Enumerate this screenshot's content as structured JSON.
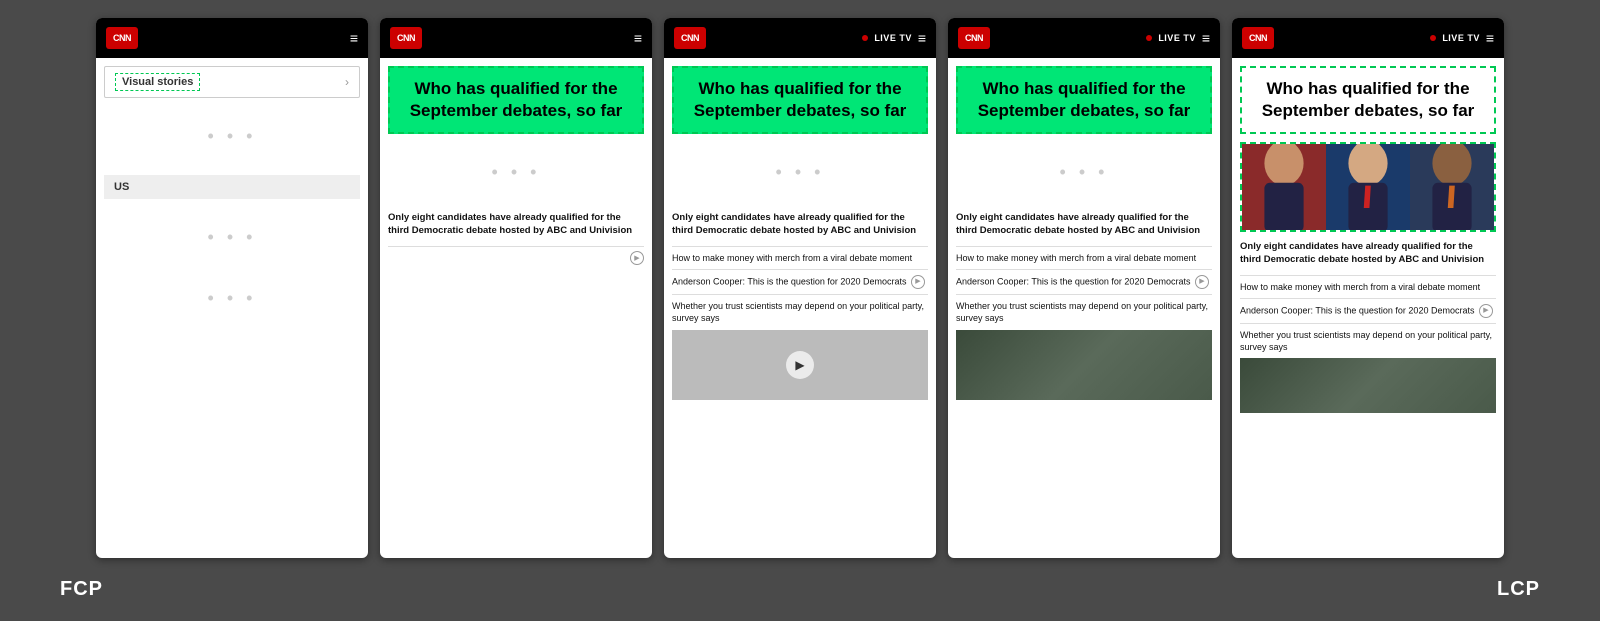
{
  "background_color": "#4a4a4a",
  "labels": {
    "fcp": "FCP",
    "lcp": "LCP"
  },
  "panels": [
    {
      "id": "panel1",
      "type": "visual_stories",
      "header": {
        "logo": "CNN",
        "show_live_tv": false,
        "show_hamburger": true
      },
      "visual_stories_label": "Visual stories",
      "us_section": "US",
      "has_dots": true
    },
    {
      "id": "panel2",
      "type": "article",
      "header": {
        "logo": "CNN",
        "show_live_tv": false,
        "show_hamburger": true
      },
      "headline": "Who has qualified for the September debates, so far",
      "main_article": "Only eight candidates have already qualified for the third Democratic debate hosted by ABC and Univision",
      "sub_articles": [],
      "has_play_button": true
    },
    {
      "id": "panel3",
      "type": "article",
      "header": {
        "logo": "CNN",
        "show_live_tv": true,
        "show_hamburger": true
      },
      "headline": "Who has qualified for the September debates, so far",
      "main_article": "Only eight candidates have already qualified for the third Democratic debate hosted by ABC and Univision",
      "sub_articles": [
        "How to make money with merch from a viral debate moment",
        "Anderson Cooper: This is the question for 2020 Democrats",
        "Whether you trust scientists may depend on your political party, survey says"
      ],
      "has_video_thumb": true,
      "video_thumb_type": "gray"
    },
    {
      "id": "panel4",
      "type": "article",
      "header": {
        "logo": "CNN",
        "show_live_tv": true,
        "show_hamburger": true
      },
      "headline": "Who has qualified for the September debates, so far",
      "main_article": "Only eight candidates have already qualified for the third Democratic debate hosted by ABC and Univision",
      "sub_articles": [
        "How to make money with merch from a viral debate moment",
        "Anderson Cooper: This is the question for 2020 Democrats",
        "Whether you trust scientists may depend on your political party, survey says"
      ],
      "has_image": true,
      "image_type": "outdoor"
    },
    {
      "id": "panel5",
      "type": "article_with_image",
      "header": {
        "logo": "CNN",
        "show_live_tv": true,
        "show_hamburger": true
      },
      "headline": "Who has qualified for the September debates, so far",
      "has_debate_image": true,
      "main_article": "Only eight candidates have already qualified for the third Democratic debate hosted by ABC and Univision",
      "sub_articles": [
        "How to make money with merch from a viral debate moment",
        "Anderson Cooper: This is the question for 2020 Democrats",
        "Whether you trust scientists may depend on your political party, survey says"
      ],
      "has_image": true,
      "image_type": "outdoor"
    }
  ]
}
